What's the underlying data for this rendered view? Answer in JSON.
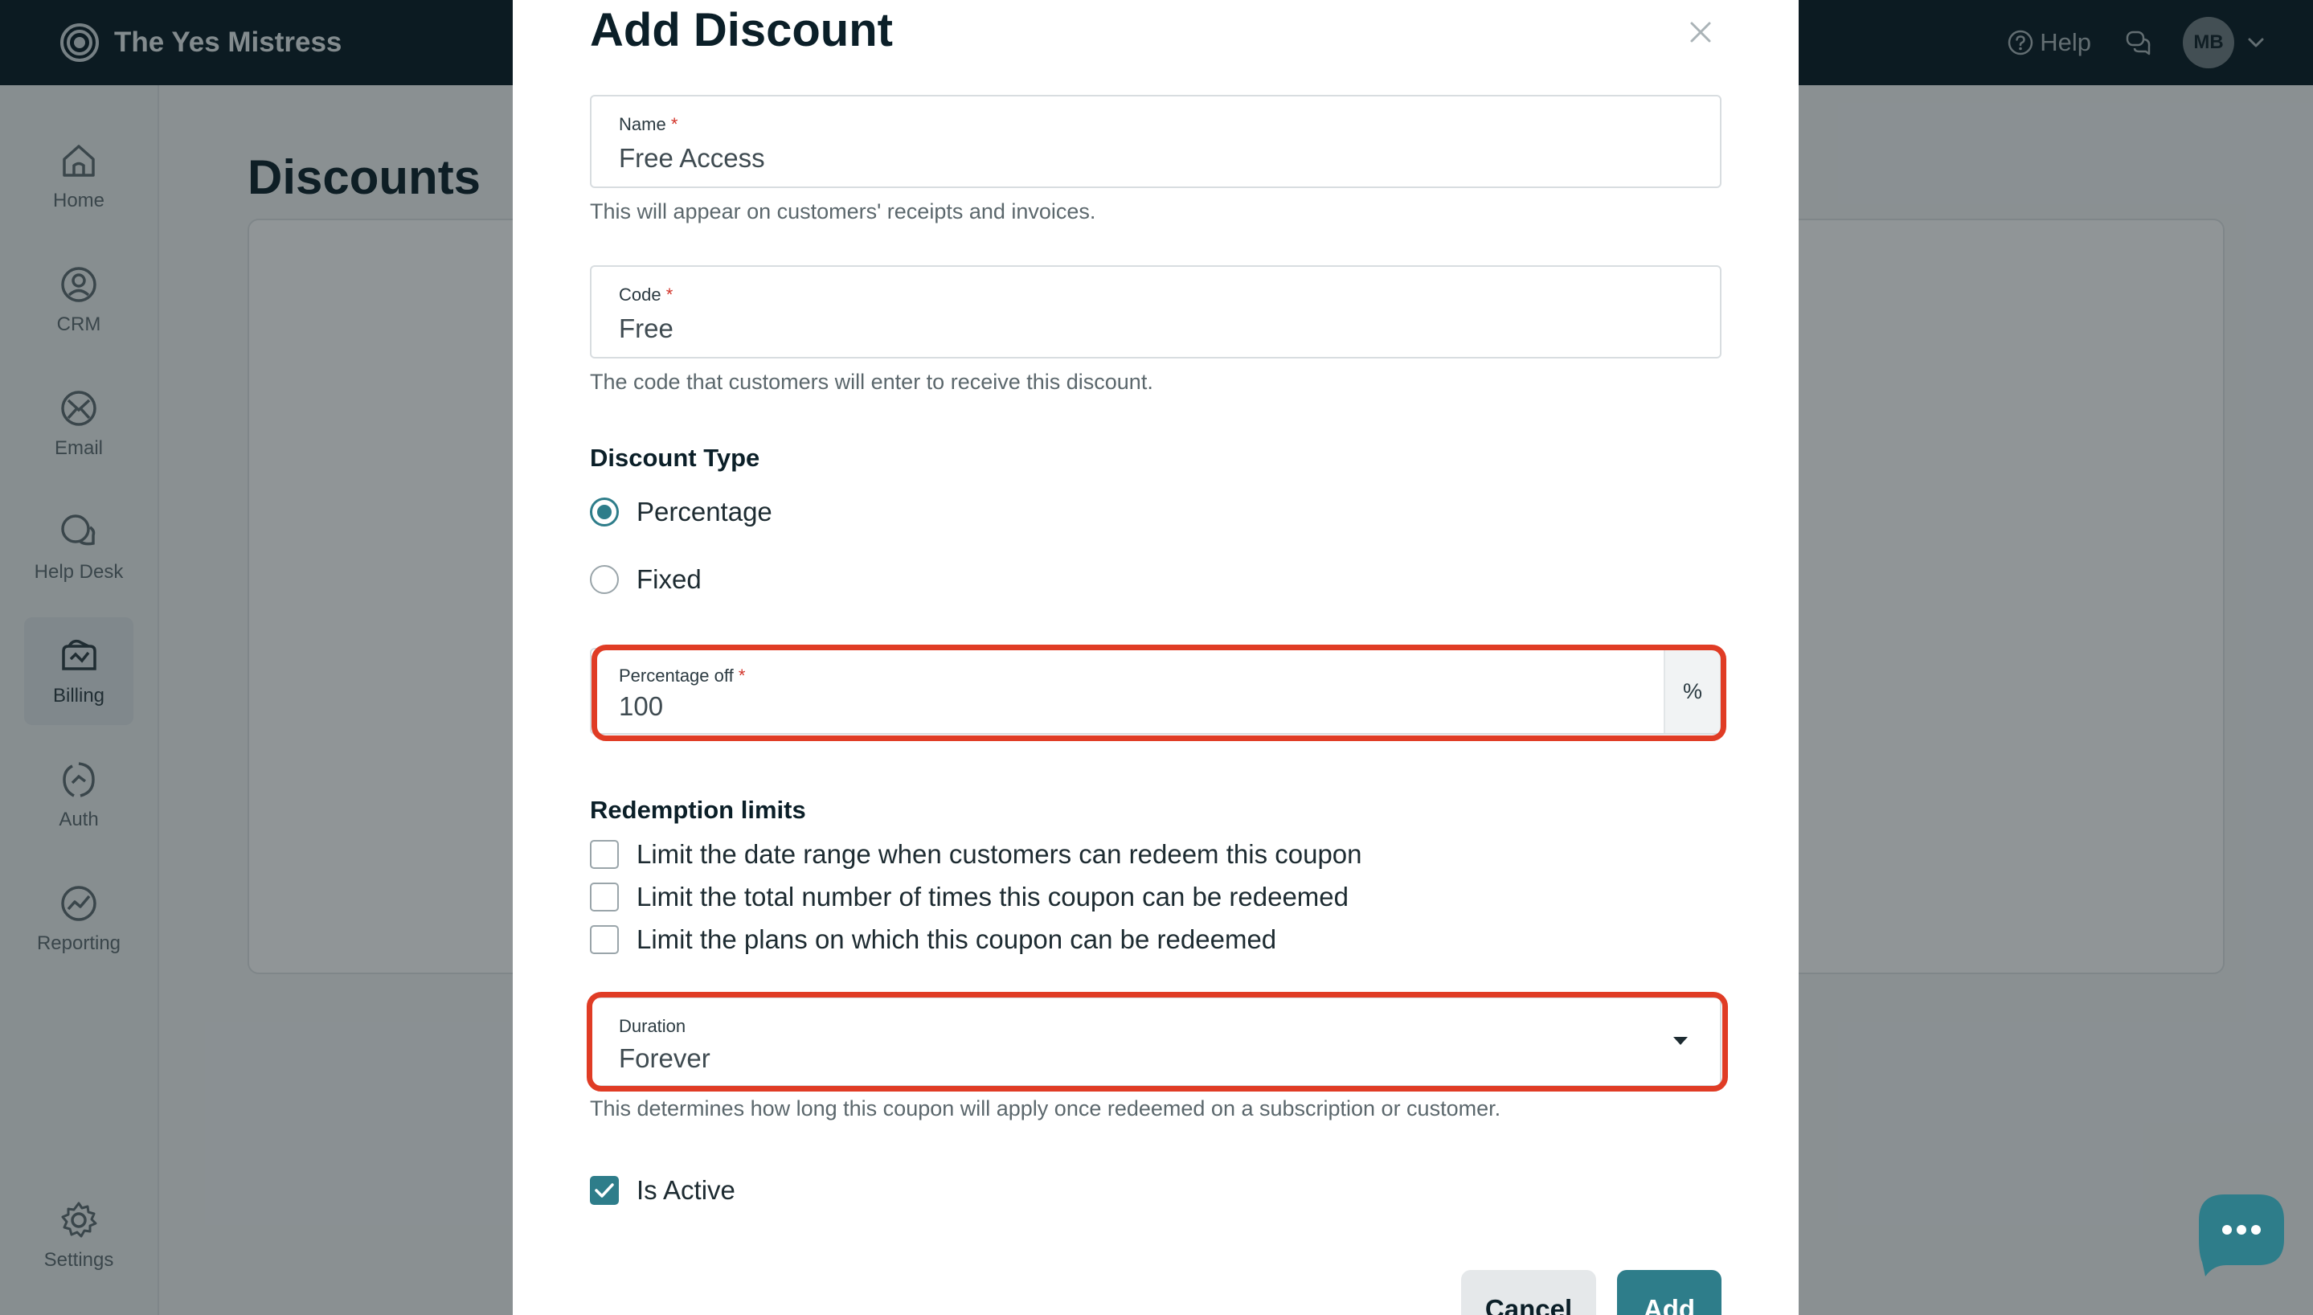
{
  "app": {
    "name": "The Yes Mistress",
    "help_label": "Help",
    "avatar_initials": "MB"
  },
  "sidebar": {
    "items": [
      {
        "label": "Home",
        "icon": "home-icon"
      },
      {
        "label": "CRM",
        "icon": "person-circle-icon"
      },
      {
        "label": "Email",
        "icon": "envelope-icon"
      },
      {
        "label": "Help Desk",
        "icon": "chat-bubbles-icon"
      },
      {
        "label": "Billing",
        "icon": "billing-icon",
        "active": true
      },
      {
        "label": "Auth",
        "icon": "auth-icon"
      },
      {
        "label": "Reporting",
        "icon": "chart-icon"
      },
      {
        "label": "Settings",
        "icon": "gear-icon"
      }
    ]
  },
  "page": {
    "title": "Discounts"
  },
  "modal": {
    "title": "Add Discount",
    "name_field": {
      "label": "Name",
      "required_mark": "*",
      "value": "Free Access",
      "help": "This will appear on customers' receipts and invoices."
    },
    "code_field": {
      "label": "Code",
      "required_mark": "*",
      "value": "Free",
      "help": "The code that customers will enter to receive this discount."
    },
    "discount_type": {
      "title": "Discount Type",
      "options": [
        "Percentage",
        "Fixed"
      ],
      "selected": "Percentage"
    },
    "percentage_field": {
      "label": "Percentage off",
      "required_mark": "*",
      "value": "100",
      "suffix": "%"
    },
    "redemption": {
      "title": "Redemption limits",
      "options": [
        "Limit the date range when customers can redeem this coupon",
        "Limit the total number of times this coupon can be redeemed",
        "Limit the plans on which this coupon can be redeemed"
      ]
    },
    "duration_field": {
      "label": "Duration",
      "value": "Forever",
      "help": "This determines how long this coupon will apply once redeemed on a subscription or customer."
    },
    "is_active": {
      "label": "Is Active",
      "checked": true
    },
    "buttons": {
      "cancel": "Cancel",
      "add": "Add"
    }
  },
  "colors": {
    "topbar": "#061a22",
    "accent": "#2e7d8a",
    "highlight": "#e03c25",
    "required": "#d2342a"
  }
}
